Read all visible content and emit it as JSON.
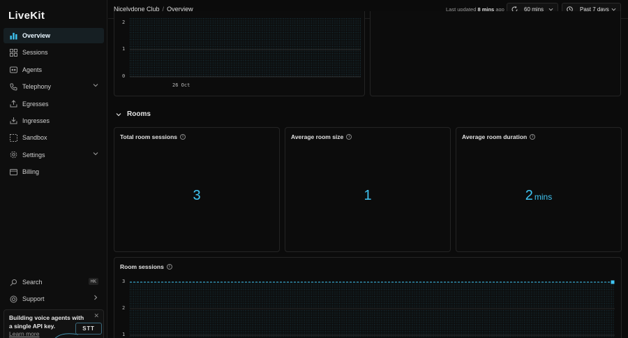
{
  "sidebar": {
    "logo": "LiveKit",
    "items": [
      {
        "label": "Overview",
        "icon": "bar-chart-icon",
        "active": true
      },
      {
        "label": "Sessions",
        "icon": "grid-icon"
      },
      {
        "label": "Agents",
        "icon": "bot-icon"
      },
      {
        "label": "Telephony",
        "icon": "phone-icon",
        "expandable": true
      },
      {
        "label": "Egresses",
        "icon": "upload-icon"
      },
      {
        "label": "Ingresses",
        "icon": "download-icon"
      },
      {
        "label": "Sandbox",
        "icon": "dashed-square-icon"
      },
      {
        "label": "Settings",
        "icon": "gear-icon",
        "expandable": true
      },
      {
        "label": "Billing",
        "icon": "card-icon"
      }
    ],
    "bottom": [
      {
        "label": "Search",
        "icon": "search-icon",
        "shortcut": "⌘K"
      },
      {
        "label": "Support",
        "icon": "lifebuoy-icon"
      }
    ],
    "promo": {
      "text": "Building voice agents with a single API key.",
      "link": "Learn more",
      "badge": "STT"
    }
  },
  "topbar": {
    "breadcrumb": [
      "Nicelydone Club",
      "Overview"
    ],
    "updated_prefix": "Last updated",
    "updated_value": "8 mins",
    "updated_suffix": "ago",
    "refresh_label": "60 mins",
    "range_label": "Past 7 days"
  },
  "top_chart": {
    "y_ticks": [
      "2",
      "1",
      "0"
    ],
    "x_tick": "26 Oct"
  },
  "rooms": {
    "section_title": "Rooms",
    "stats": [
      {
        "title": "Total room sessions",
        "value": "3",
        "unit": ""
      },
      {
        "title": "Average room size",
        "value": "1",
        "unit": ""
      },
      {
        "title": "Average room duration",
        "value": "2",
        "unit": "mins"
      }
    ],
    "sessions_chart_title": "Room sessions"
  },
  "chart_data": {
    "type": "line",
    "title": "Room sessions",
    "y_ticks": [
      "3",
      "2",
      "1"
    ],
    "series": [
      {
        "values": [
          3,
          3
        ]
      }
    ],
    "grid": true
  },
  "colors": {
    "accent": "#3fc4f2",
    "background": "#0b0b0b"
  }
}
